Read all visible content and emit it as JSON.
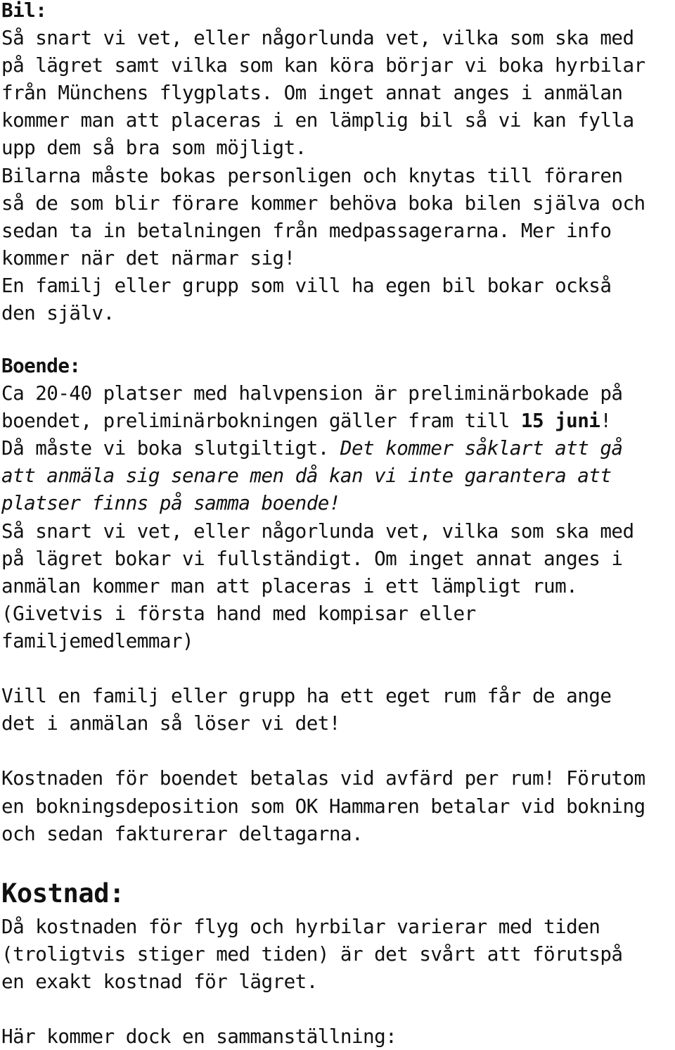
{
  "sections": {
    "bil": {
      "heading": "Bil:",
      "lines": [
        "Så snart vi vet, eller någorlunda vet, vilka som ska med",
        "på lägret samt vilka som kan köra börjar vi boka hyrbilar",
        "från Münchens flygplats. Om inget annat anges i anmälan",
        "kommer man att placeras i en lämplig bil så vi kan fylla",
        "upp dem så bra som möjligt.",
        "Bilarna måste bokas personligen och knytas till föraren",
        "så de som blir förare kommer behöva boka bilen själva och",
        "sedan ta in betalningen från medpassagerarna. Mer info",
        "kommer när det närmar sig!",
        "En familj eller grupp som vill ha egen bil bokar också",
        "den själv."
      ]
    },
    "boende": {
      "heading": "Boende:",
      "line1": "Ca 20-40 platser med halvpension är preliminärbokade på",
      "line2_pre": "boendet, preliminärbokningen gäller fram till ",
      "line2_bold": "15 juni",
      "line2_post": "!",
      "line3_pre": "Då måste vi boka slutgiltigt. ",
      "line3_italic": "Det kommer såklart att gå",
      "line4_italic": "att anmäla sig senare men då kan vi inte garantera att",
      "line5_italic": "platser finns på samma boende!",
      "lines_after": [
        "Så snart vi vet, eller någorlunda vet, vilka som ska med",
        "på lägret bokar vi fullständigt. Om inget annat anges i",
        "anmälan kommer man att placeras i ett lämpligt rum.",
        "(Givetvis i första hand med kompisar eller",
        "familjemedlemmar)"
      ],
      "group_room": [
        "Vill en familj eller grupp ha ett eget rum får de ange",
        "det i anmälan så löser vi det!"
      ],
      "cost_note": [
        "Kostnaden för boendet betalas vid avfärd per rum! Förutom",
        "en bokningsdeposition som OK Hammaren betalar vid bokning",
        "och sedan fakturerar deltagarna."
      ]
    },
    "kostnad": {
      "heading": "Kostnad:",
      "lines": [
        "Då kostnaden för flyg och hyrbilar varierar med tiden",
        "(troligtvis stiger med tiden) är det svårt att förutspå",
        "en exakt kostnad för lägret."
      ],
      "summary_intro": "Här kommer dock en sammanställning:"
    }
  }
}
